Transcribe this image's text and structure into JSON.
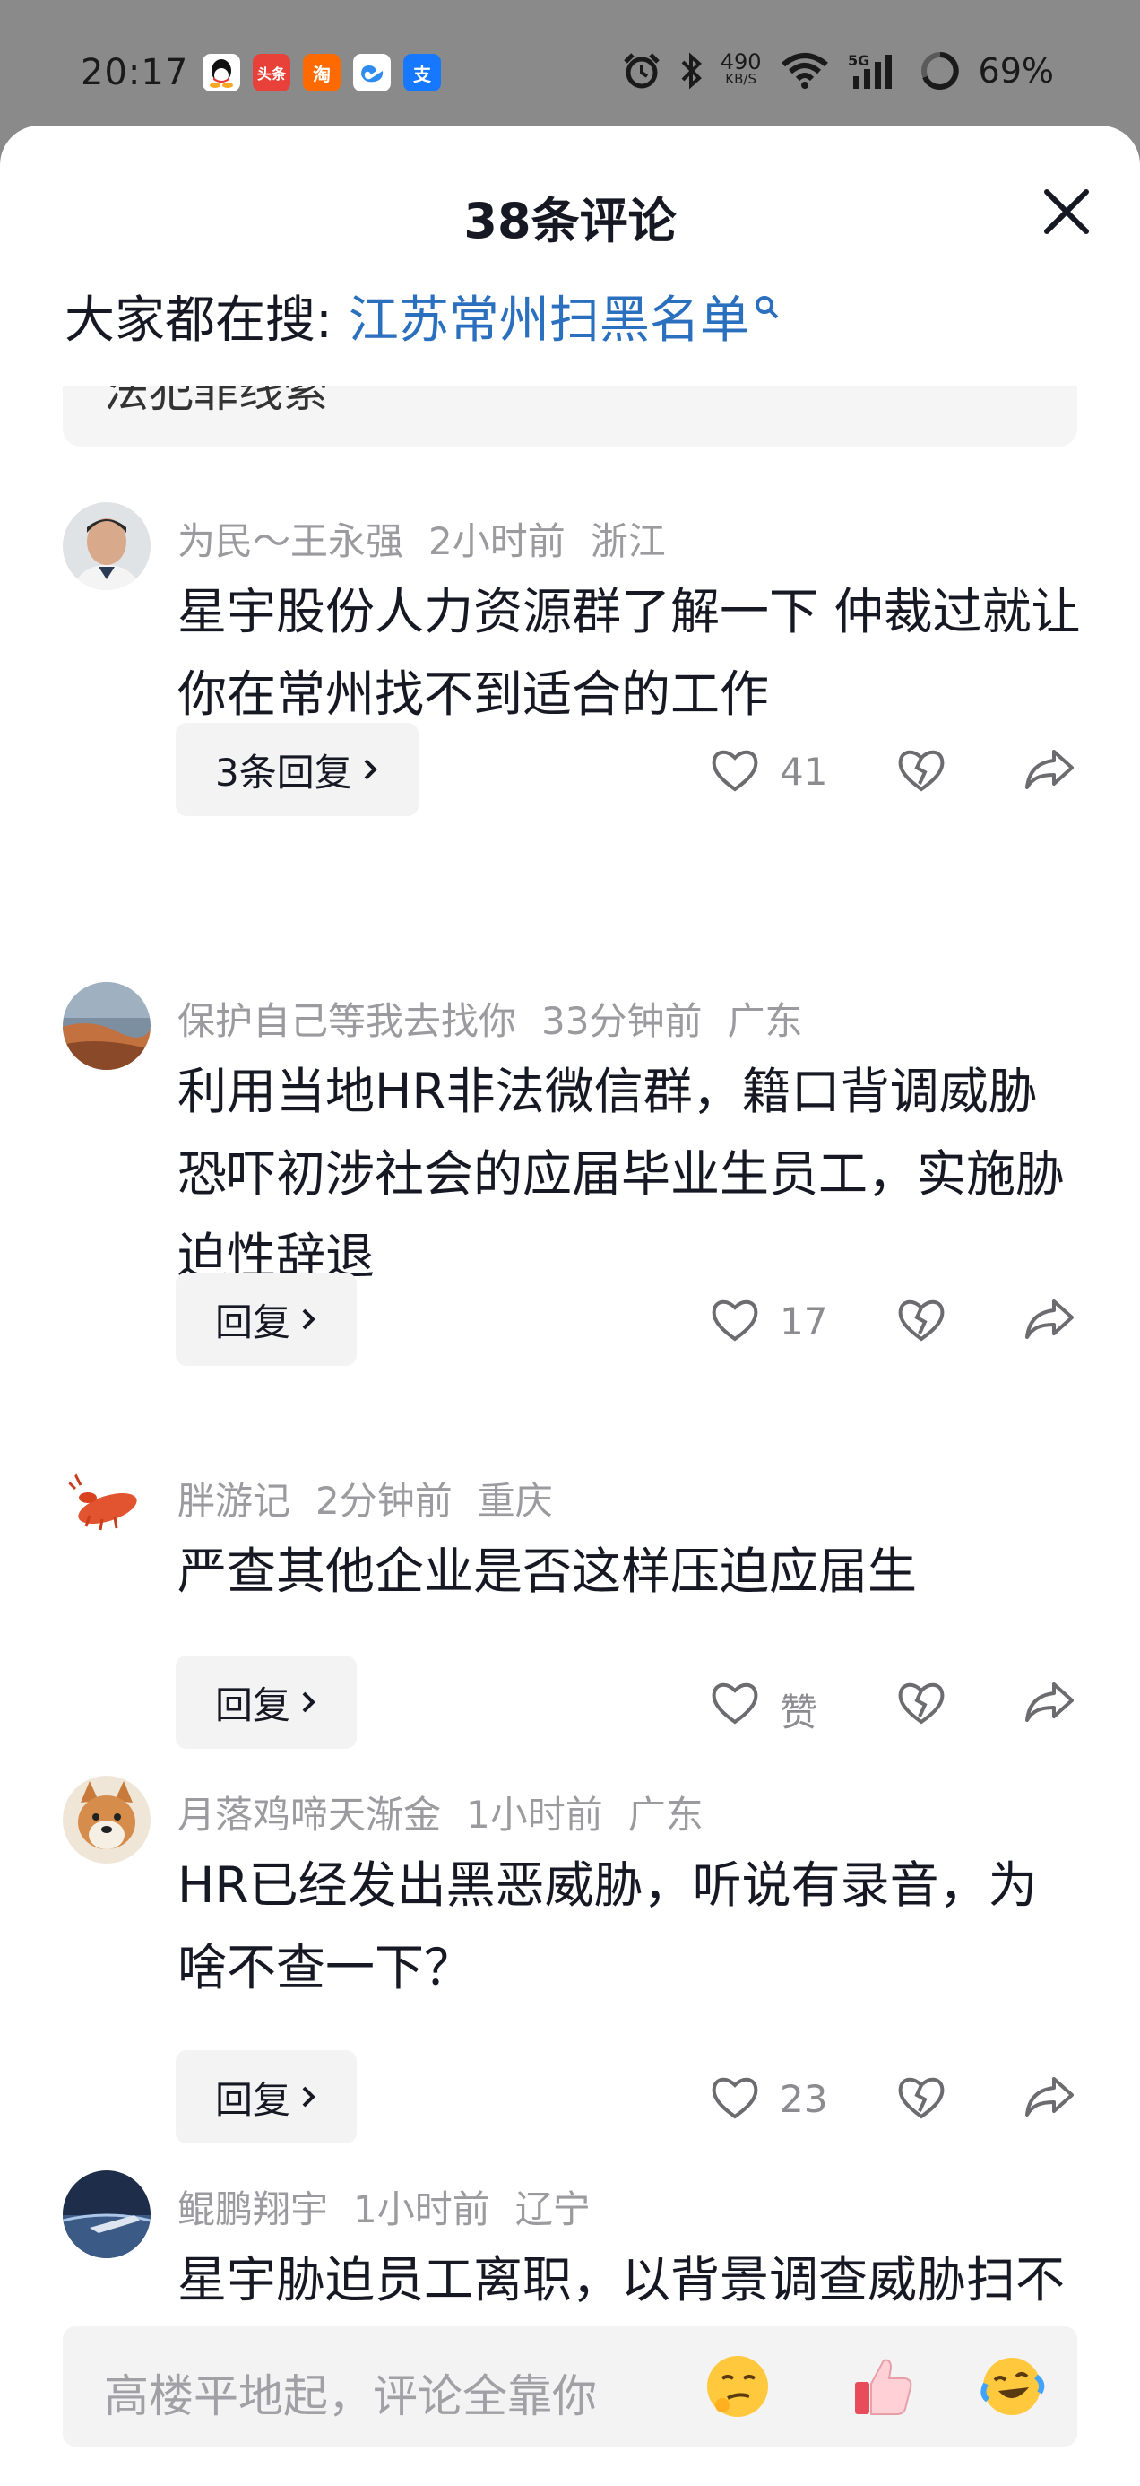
{
  "status_bar": {
    "time": "20:17",
    "apps": [
      {
        "name": "qq-icon",
        "label": "",
        "color": "#ffffff"
      },
      {
        "name": "toutiao-icon",
        "label": "头条",
        "color": "#e8413a"
      },
      {
        "name": "taobao-icon",
        "label": "淘",
        "color": "#ff6a00"
      },
      {
        "name": "baidu-netdisk-icon",
        "label": "",
        "color": "#3a8ef0"
      },
      {
        "name": "alipay-icon",
        "label": "支",
        "color": "#1677ff"
      }
    ],
    "net_speed_value": "490",
    "net_speed_unit": "KB/S",
    "battery": "69%"
  },
  "header": {
    "title": "38条评论",
    "search_prefix": "大家都在搜:",
    "search_term": "江苏常州扫黑名单"
  },
  "prev_card_text": "法犯罪线索",
  "comments": [
    {
      "user": "为民～王永强",
      "time": "2小时前",
      "location": "浙江",
      "text": "星宇股份人力资源群了解一下 仲裁过就让你在常州找不到适合的工作",
      "reply_label": "3条回复",
      "likes": "41",
      "avatar": "person"
    },
    {
      "user": "保护自己等我去找你",
      "time": "33分钟前",
      "location": "广东",
      "text": "利用当地HR非法微信群，籍口背调威胁恐吓初涉社会的应届毕业生员工，实施胁迫性辞退",
      "reply_label": "回复",
      "likes": "17",
      "avatar": "beach"
    },
    {
      "user": "胖游记",
      "time": "2分钟前",
      "location": "重庆",
      "text": "严查其他企业是否这样压迫应届生",
      "reply_label": "回复",
      "likes": "赞",
      "avatar": "lobster"
    },
    {
      "user": "月落鸡啼天渐金",
      "time": "1小时前",
      "location": "广东",
      "text": "HR已经发出黑恶威胁，听说有录音，为啥不查一下？",
      "reply_label": "回复",
      "likes": "23",
      "avatar": "dog"
    },
    {
      "user": "鲲鹏翔宇",
      "time": "1小时前",
      "location": "辽宁",
      "text": "星宇胁迫员工离职，以背景调查威胁扫不扫？？",
      "reply_label": "",
      "likes": "",
      "avatar": "plane"
    }
  ],
  "input": {
    "placeholder": "高楼平地起，评论全靠你",
    "emojis": [
      "smirk-emoji-icon",
      "thumbs-up-emoji-icon",
      "laugh-cry-emoji-icon"
    ]
  },
  "colors": {
    "accent_link": "#2b6fbf",
    "meta_gray": "#9a9a9f",
    "text": "#161823",
    "sheet_bg": "#ffffff",
    "dim_bg": "#8a8a8a"
  }
}
